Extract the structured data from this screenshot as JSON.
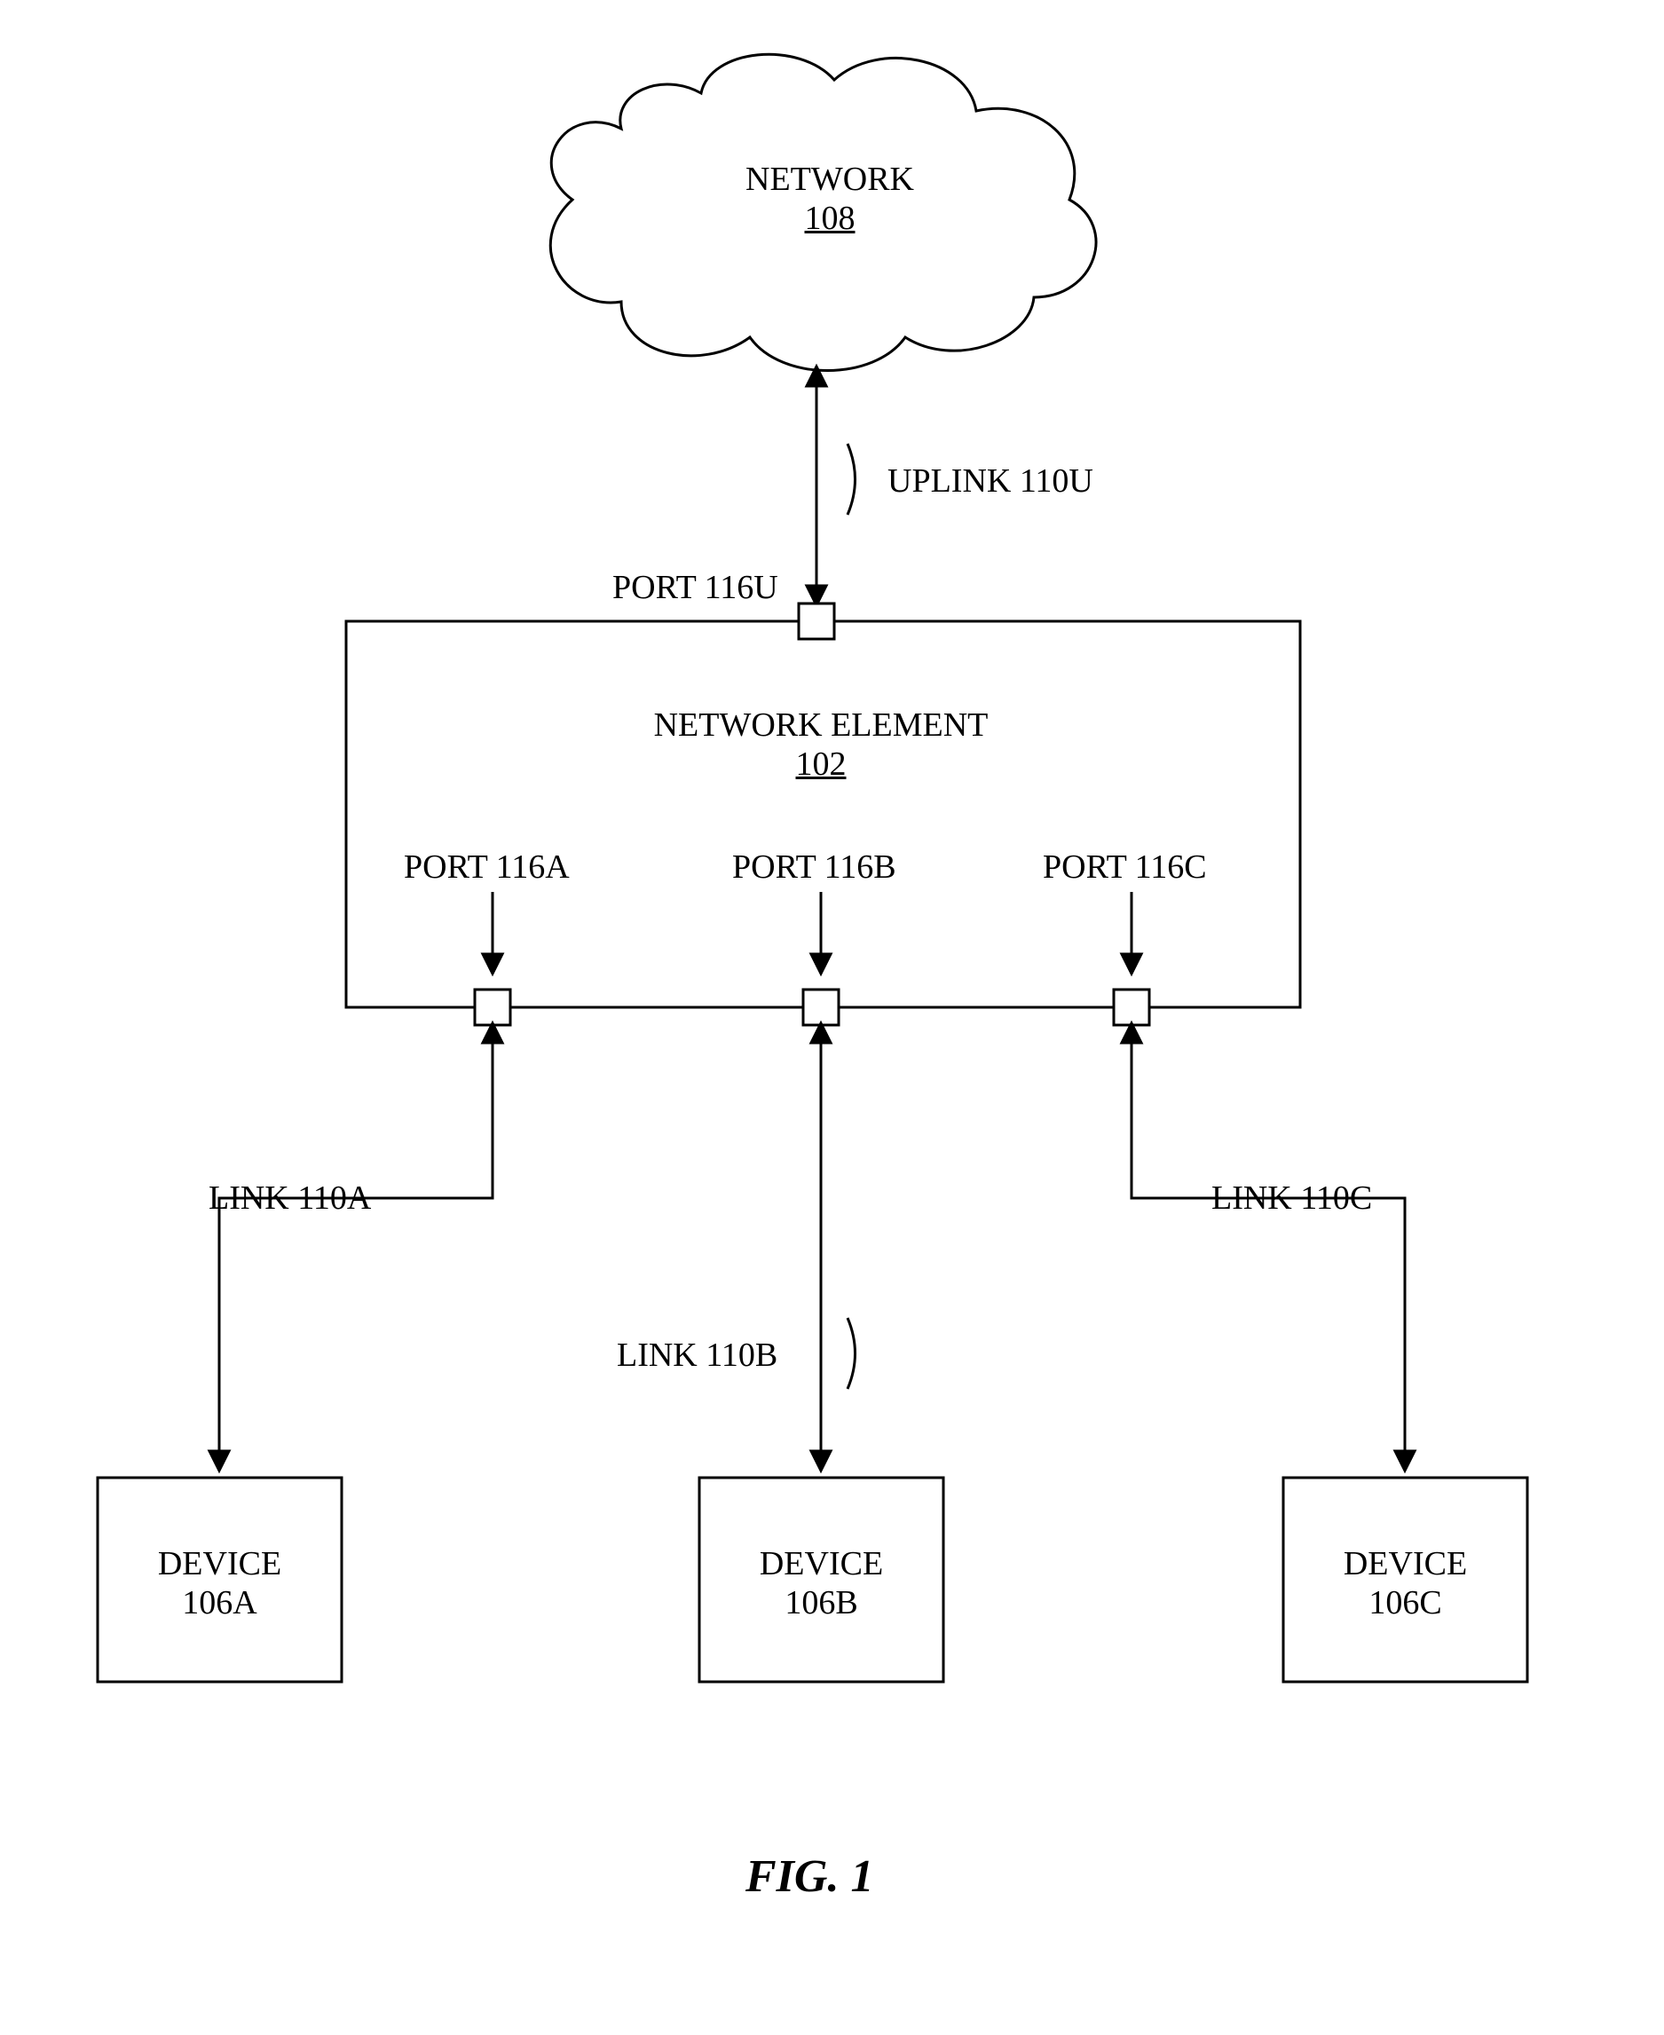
{
  "cloud": {
    "label": "NETWORK",
    "ref": "108"
  },
  "uplink": {
    "label": "UPLINK 110U",
    "port": "PORT 116U"
  },
  "element": {
    "label": "NETWORK ELEMENT",
    "ref": "102"
  },
  "ports": {
    "a": "PORT 116A",
    "b": "PORT 116B",
    "c": "PORT 116C"
  },
  "links": {
    "a": "LINK 110A",
    "b": "LINK 110B",
    "c": "LINK 110C"
  },
  "devices": {
    "a": {
      "label": "DEVICE",
      "ref": "106A"
    },
    "b": {
      "label": "DEVICE",
      "ref": "106B"
    },
    "c": {
      "label": "DEVICE",
      "ref": "106C"
    }
  },
  "figure": "FIG. 1"
}
